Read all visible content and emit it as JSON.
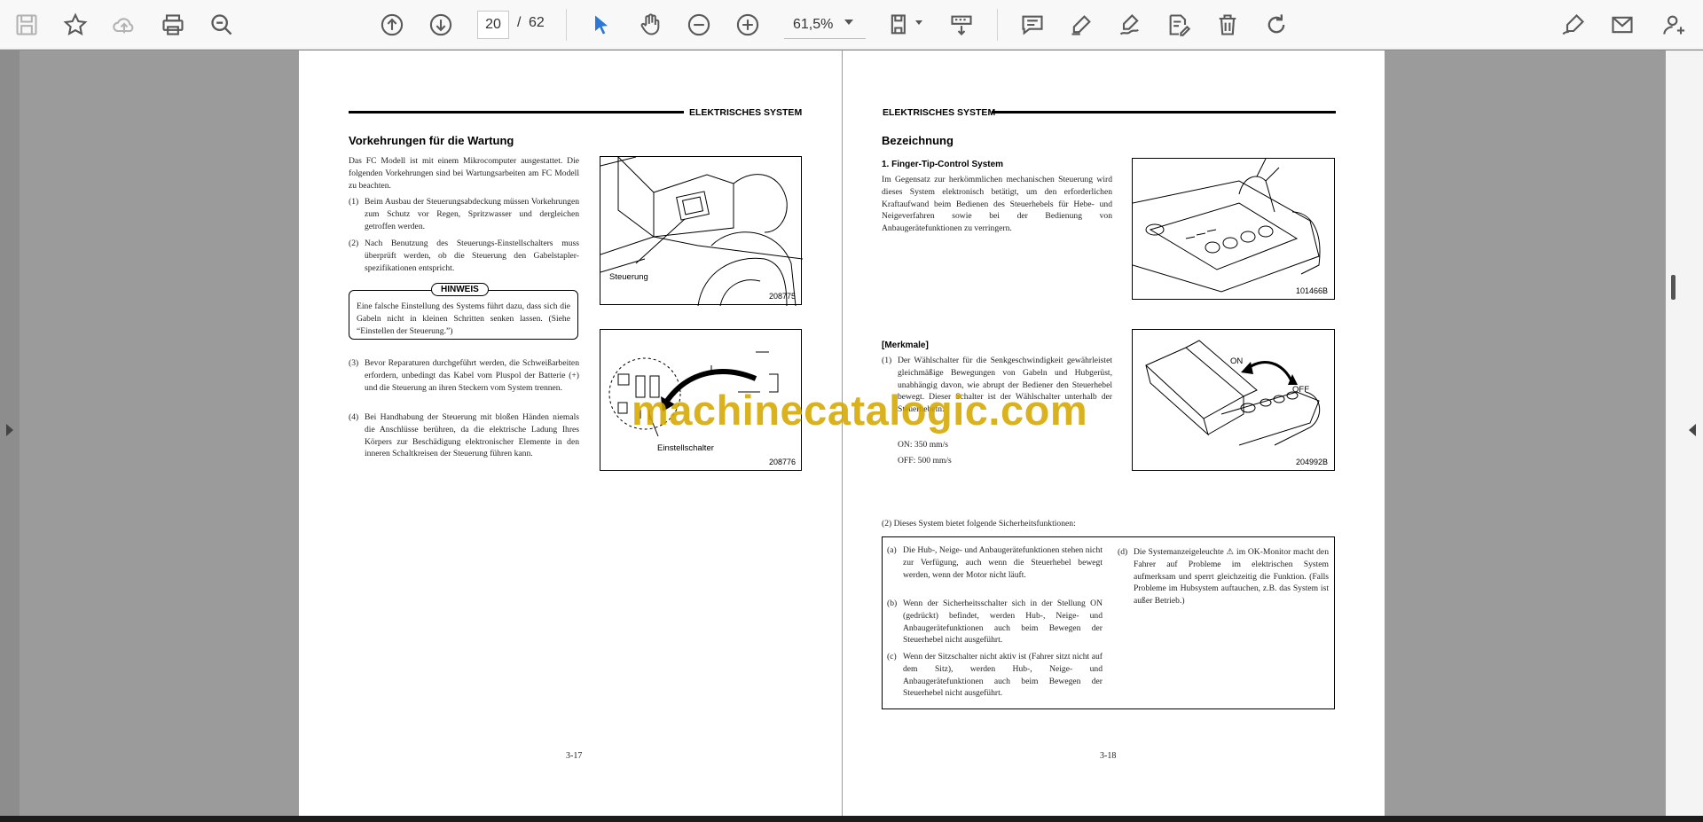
{
  "toolbar": {
    "page_current": "20",
    "page_sep": "/",
    "page_total": "62",
    "zoom": "61,5%",
    "icons": [
      "save-icon",
      "bookmark-star-icon",
      "cloud-upload-icon",
      "print-icon",
      "search-zoom-icon",
      "page-up-icon",
      "page-down-icon",
      "select-cursor-icon",
      "hand-tool-icon",
      "zoom-out-icon",
      "zoom-in-icon",
      "page-fit-icon",
      "scroll-mode-icon",
      "comment-icon",
      "highlight-pen-icon",
      "draw-icon",
      "edit-text-icon",
      "delete-icon",
      "rotate-icon",
      "sign-icon",
      "email-icon",
      "add-user-icon"
    ]
  },
  "left_page": {
    "header": "ELEKTRISCHES SYSTEM",
    "title": "Vorkehrungen für die Wartung",
    "intro": "Das FC Modell ist mit einem Mikrocomputer ausgestattet. Die folgenden Vorkehrungen sind bei Wartungsarbeiten am FC Modell zu beachten.",
    "items": [
      {
        "num": "(1)",
        "text": "Beim Ausbau der Steuerungsabdeckung müssen Vorkehrungen zum Schutz vor Regen, Spritzwasser und dergleichen getroffen werden."
      },
      {
        "num": "(2)",
        "text": "Nach Benutzung des Steuerungs-Einstellschalters muss überprüft werden, ob die Steuerung den Gabelstapler-spezifikationen entspricht."
      },
      {
        "num": "(3)",
        "text": "Bevor Reparaturen durchgeführt werden, die Schweißarbeiten erfordern, unbedingt das Kabel vom Pluspol der Batterie (+) und die Steuerung an ihren Steckern vom System trennen."
      },
      {
        "num": "(4)",
        "text": "Bei Handhabung der Steuerung mit bloßen Händen niemals die Anschlüsse berühren, da die elektrische Ladung Ihres Körpers zur Beschädigung elektronischer Elemente in den inneren Schaltkreisen der Steuerung führen kann."
      }
    ],
    "notice_title": "HINWEIS",
    "notice_text": "Eine falsche Einstellung des Systems führt dazu, dass sich die Gabeln nicht in kleinen Schritten senken lassen. (Siehe “Einstellen der Steuerung.”)",
    "fig1_label": "Steuerung",
    "fig1_code": "208775",
    "fig2_label": "Einstellschalter",
    "fig2_code": "208776",
    "page_number": "3-17"
  },
  "right_page": {
    "header": "ELEKTRISCHES SYSTEM",
    "title": "Bezeichnung",
    "section1": "1.   Finger-Tip-Control System",
    "section1_text": "Im Gegensatz zur herkömmlichen mechanischen Steuerung wird dieses System elektronisch betätigt, um den erforderlichen Kraftaufwand beim Bedienen des Steuerhebels für Hebe- und Neigeverfahren sowie bei der Bedienung von Anbaugerätefunktionen zu verringern.",
    "fig3_code": "101466B",
    "merkmale": "[Merkmale]",
    "merkmale_item": {
      "num": "(1)",
      "text": "Der Wählschalter für die Senkgeschwindigkeit gewährleistet gleichmäßige Bewegungen von Gabeln und Hubgerüst, unabhängig davon, wie abrupt der Bediener den Steuerhebel bewegt. Dieser Schalter ist der Wählschalter unterhalb der Steuerhebeln."
    },
    "on_speed": "ON: 350 mm/s",
    "off_speed": "OFF: 500 mm/s",
    "fig4_on": "ON",
    "fig4_off": "OFF",
    "fig4_code": "204992B",
    "safety_intro": "(2)  Dieses System bietet folgende Sicherheitsfunktionen:",
    "safety_items": [
      {
        "num": "(a)",
        "text": "Die Hub-, Neige- und Anbaugerätefunktionen stehen nicht zur Verfügung, auch wenn die Steuerhebel bewegt werden, wenn der Motor nicht läuft."
      },
      {
        "num": "(b)",
        "text": "Wenn der Sicherheitsschalter sich in der Stellung ON (gedrückt) befindet, werden Hub-, Neige- und Anbaugerätefunktionen auch beim Bewegen der Steuerhebel nicht ausgeführt."
      },
      {
        "num": "(c)",
        "text": "Wenn der Sitzschalter nicht aktiv ist (Fahrer sitzt nicht auf dem Sitz), werden Hub-, Neige- und Anbaugerätefunktionen auch beim Bewegen der Steuerhebel nicht ausgeführt."
      },
      {
        "num": "(d)",
        "text": "Die Systemanzeigeleuchte ⚠ im OK-Monitor macht den Fahrer auf Probleme im elektrischen System aufmerksam und sperrt gleichzeitig die Funktion. (Falls Probleme im Hubsystem auftauchen, z.B. das System ist außer Betrieb.)"
      }
    ],
    "page_number": "3-18"
  },
  "watermark": "machinecatalogic.com"
}
